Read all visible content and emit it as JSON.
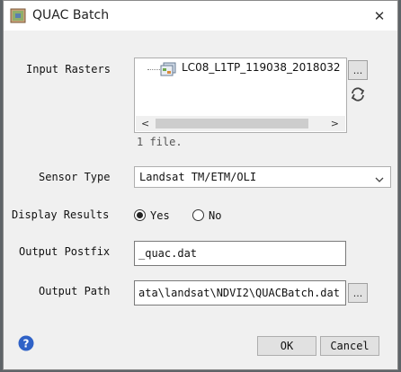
{
  "window": {
    "title": "QUAC Batch",
    "close_label": "✕"
  },
  "input_rasters": {
    "label": "Input Rasters",
    "files": [
      "LC08_L1TP_119038_2018032"
    ],
    "browse_label": "...",
    "file_count": "1 file.",
    "scroll_left": "<",
    "scroll_right": ">"
  },
  "sensor_type": {
    "label": "Sensor Type",
    "value": "Landsat TM/ETM/OLI"
  },
  "display_results": {
    "label": "Display Results",
    "options": [
      {
        "label": "Yes",
        "selected": true
      },
      {
        "label": "No",
        "selected": false
      }
    ]
  },
  "output_postfix": {
    "label": "Output Postfix",
    "value": "_quac.dat"
  },
  "output_path": {
    "label": "Output Path",
    "value": "ata\\landsat\\NDVI2\\QUACBatch.dat",
    "browse_label": "..."
  },
  "buttons": {
    "ok": "OK",
    "cancel": "Cancel"
  },
  "colors": {
    "help_blue": "#2f62c7",
    "window_bg": "#f0f0f0",
    "backdrop": "#5f6468"
  }
}
